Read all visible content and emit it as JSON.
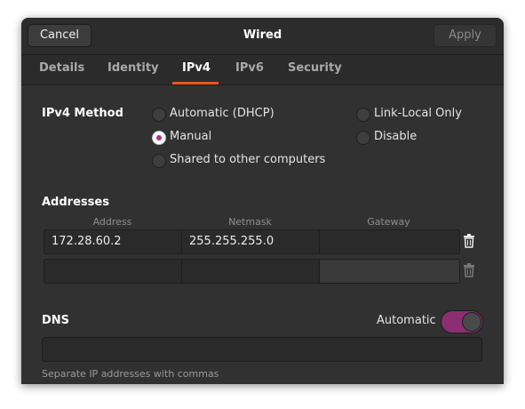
{
  "header": {
    "cancel_label": "Cancel",
    "title": "Wired",
    "apply_label": "Apply"
  },
  "tabs": [
    "Details",
    "Identity",
    "IPv4",
    "IPv6",
    "Security"
  ],
  "active_tab": "IPv4",
  "accent_colors": {
    "tab_underline": "#e95420",
    "selection": "#b12e85",
    "toggle_on": "#8d2e74"
  },
  "ipv4_method": {
    "label": "IPv4 Method",
    "options": [
      {
        "label": "Automatic (DHCP)",
        "checked": false
      },
      {
        "label": "Manual",
        "checked": true
      },
      {
        "label": "Shared to other computers",
        "checked": false
      },
      {
        "label": "Link-Local Only",
        "checked": false
      },
      {
        "label": "Disable",
        "checked": false
      }
    ]
  },
  "addresses": {
    "label": "Addresses",
    "columns": [
      "Address",
      "Netmask",
      "Gateway"
    ],
    "rows": [
      {
        "address": "172.28.60.2",
        "netmask": "255.255.255.0",
        "gateway": ""
      },
      {
        "address": "",
        "netmask": "",
        "gateway": ""
      }
    ],
    "delete_icon": "trash-icon"
  },
  "dns": {
    "label": "DNS",
    "automatic_label": "Automatic",
    "automatic_on": true,
    "value": "",
    "hint": "Separate IP addresses with commas"
  }
}
